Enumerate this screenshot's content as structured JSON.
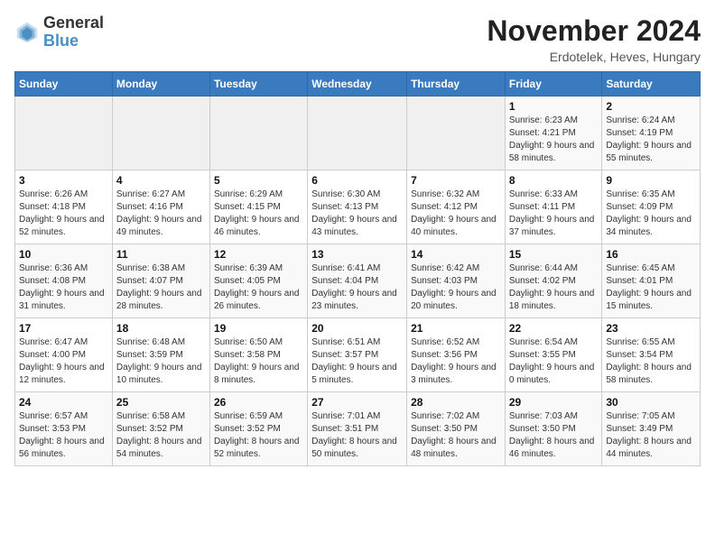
{
  "header": {
    "logo_text_general": "General",
    "logo_text_blue": "Blue",
    "month_year": "November 2024",
    "location": "Erdotelek, Heves, Hungary"
  },
  "days_of_week": [
    "Sunday",
    "Monday",
    "Tuesday",
    "Wednesday",
    "Thursday",
    "Friday",
    "Saturday"
  ],
  "weeks": [
    [
      {
        "day": "",
        "info": ""
      },
      {
        "day": "",
        "info": ""
      },
      {
        "day": "",
        "info": ""
      },
      {
        "day": "",
        "info": ""
      },
      {
        "day": "",
        "info": ""
      },
      {
        "day": "1",
        "info": "Sunrise: 6:23 AM\nSunset: 4:21 PM\nDaylight: 9 hours and 58 minutes."
      },
      {
        "day": "2",
        "info": "Sunrise: 6:24 AM\nSunset: 4:19 PM\nDaylight: 9 hours and 55 minutes."
      }
    ],
    [
      {
        "day": "3",
        "info": "Sunrise: 6:26 AM\nSunset: 4:18 PM\nDaylight: 9 hours and 52 minutes."
      },
      {
        "day": "4",
        "info": "Sunrise: 6:27 AM\nSunset: 4:16 PM\nDaylight: 9 hours and 49 minutes."
      },
      {
        "day": "5",
        "info": "Sunrise: 6:29 AM\nSunset: 4:15 PM\nDaylight: 9 hours and 46 minutes."
      },
      {
        "day": "6",
        "info": "Sunrise: 6:30 AM\nSunset: 4:13 PM\nDaylight: 9 hours and 43 minutes."
      },
      {
        "day": "7",
        "info": "Sunrise: 6:32 AM\nSunset: 4:12 PM\nDaylight: 9 hours and 40 minutes."
      },
      {
        "day": "8",
        "info": "Sunrise: 6:33 AM\nSunset: 4:11 PM\nDaylight: 9 hours and 37 minutes."
      },
      {
        "day": "9",
        "info": "Sunrise: 6:35 AM\nSunset: 4:09 PM\nDaylight: 9 hours and 34 minutes."
      }
    ],
    [
      {
        "day": "10",
        "info": "Sunrise: 6:36 AM\nSunset: 4:08 PM\nDaylight: 9 hours and 31 minutes."
      },
      {
        "day": "11",
        "info": "Sunrise: 6:38 AM\nSunset: 4:07 PM\nDaylight: 9 hours and 28 minutes."
      },
      {
        "day": "12",
        "info": "Sunrise: 6:39 AM\nSunset: 4:05 PM\nDaylight: 9 hours and 26 minutes."
      },
      {
        "day": "13",
        "info": "Sunrise: 6:41 AM\nSunset: 4:04 PM\nDaylight: 9 hours and 23 minutes."
      },
      {
        "day": "14",
        "info": "Sunrise: 6:42 AM\nSunset: 4:03 PM\nDaylight: 9 hours and 20 minutes."
      },
      {
        "day": "15",
        "info": "Sunrise: 6:44 AM\nSunset: 4:02 PM\nDaylight: 9 hours and 18 minutes."
      },
      {
        "day": "16",
        "info": "Sunrise: 6:45 AM\nSunset: 4:01 PM\nDaylight: 9 hours and 15 minutes."
      }
    ],
    [
      {
        "day": "17",
        "info": "Sunrise: 6:47 AM\nSunset: 4:00 PM\nDaylight: 9 hours and 12 minutes."
      },
      {
        "day": "18",
        "info": "Sunrise: 6:48 AM\nSunset: 3:59 PM\nDaylight: 9 hours and 10 minutes."
      },
      {
        "day": "19",
        "info": "Sunrise: 6:50 AM\nSunset: 3:58 PM\nDaylight: 9 hours and 8 minutes."
      },
      {
        "day": "20",
        "info": "Sunrise: 6:51 AM\nSunset: 3:57 PM\nDaylight: 9 hours and 5 minutes."
      },
      {
        "day": "21",
        "info": "Sunrise: 6:52 AM\nSunset: 3:56 PM\nDaylight: 9 hours and 3 minutes."
      },
      {
        "day": "22",
        "info": "Sunrise: 6:54 AM\nSunset: 3:55 PM\nDaylight: 9 hours and 0 minutes."
      },
      {
        "day": "23",
        "info": "Sunrise: 6:55 AM\nSunset: 3:54 PM\nDaylight: 8 hours and 58 minutes."
      }
    ],
    [
      {
        "day": "24",
        "info": "Sunrise: 6:57 AM\nSunset: 3:53 PM\nDaylight: 8 hours and 56 minutes."
      },
      {
        "day": "25",
        "info": "Sunrise: 6:58 AM\nSunset: 3:52 PM\nDaylight: 8 hours and 54 minutes."
      },
      {
        "day": "26",
        "info": "Sunrise: 6:59 AM\nSunset: 3:52 PM\nDaylight: 8 hours and 52 minutes."
      },
      {
        "day": "27",
        "info": "Sunrise: 7:01 AM\nSunset: 3:51 PM\nDaylight: 8 hours and 50 minutes."
      },
      {
        "day": "28",
        "info": "Sunrise: 7:02 AM\nSunset: 3:50 PM\nDaylight: 8 hours and 48 minutes."
      },
      {
        "day": "29",
        "info": "Sunrise: 7:03 AM\nSunset: 3:50 PM\nDaylight: 8 hours and 46 minutes."
      },
      {
        "day": "30",
        "info": "Sunrise: 7:05 AM\nSunset: 3:49 PM\nDaylight: 8 hours and 44 minutes."
      }
    ]
  ]
}
